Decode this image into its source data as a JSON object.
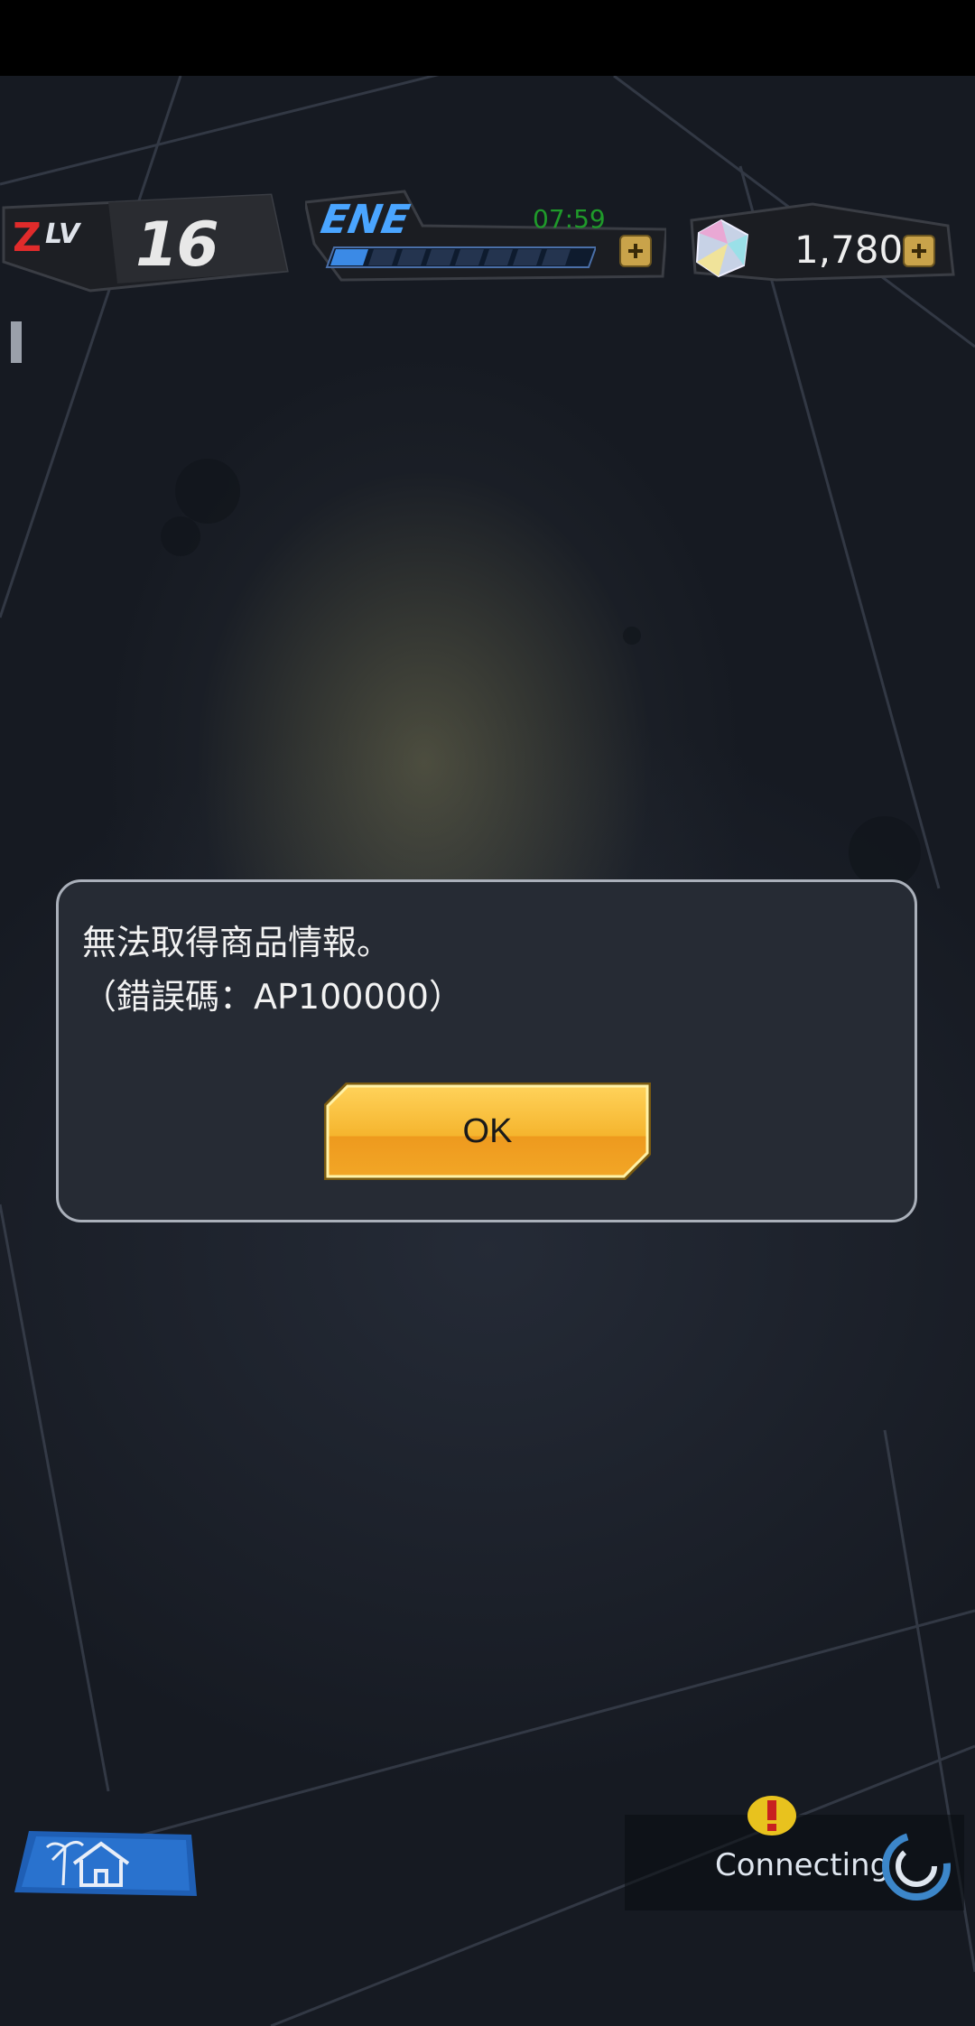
{
  "hud": {
    "level": {
      "prefix": "Z",
      "label": "LV",
      "value": "16"
    },
    "energy": {
      "label": "ENE",
      "timer": "07:59"
    },
    "gems": {
      "count": "1,780"
    }
  },
  "dialog": {
    "message_line1": "無法取得商品情報。",
    "message_line2": "（錯誤碼：AP100000）",
    "ok_label": "OK"
  },
  "footer": {
    "status_text": "Connecting"
  },
  "icons": [
    "home-icon",
    "palm-tree-icon",
    "gem-icon",
    "plus-icon",
    "alert-icon",
    "spinner-icon"
  ],
  "colors": {
    "accent_ok": "#f5b52e",
    "energy": "#4aa5ff",
    "level_red": "#e02b2b"
  }
}
